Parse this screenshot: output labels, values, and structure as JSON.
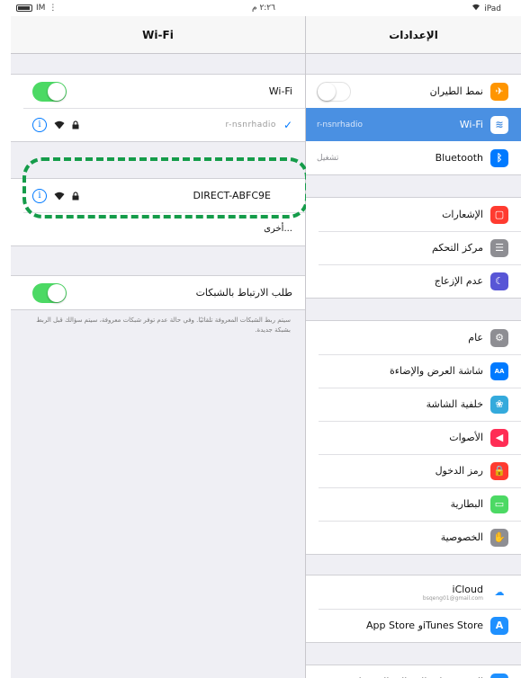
{
  "status_bar": {
    "carrier": "IM",
    "time": "٢:٢٦ م",
    "device": "iPad"
  },
  "detail": {
    "title": "Wi-Fi",
    "wifi_label": "Wi-Fi",
    "wifi_on": true,
    "connected_network": "r-nsnrhadio",
    "highlighted_network": "DIRECT-ABFC9E",
    "other_label": "أخرى...",
    "ask_to_join_label": "طلب الارتباط بالشبكات",
    "ask_to_join_on": true,
    "ask_to_join_note": "سيتم ربط الشبكات المعروفة تلقائيًا. وفي حالة عدم توفر شبكات معروفة، سيتم سؤالك قبل الربط بشبكة جديدة."
  },
  "master": {
    "title": "الإعدادات",
    "groups": [
      [
        {
          "name": "airplane",
          "label": "نمط الطيران",
          "icon": "airplane-icon",
          "color": "#ff9500",
          "glyph": "✈",
          "toggle": "off"
        },
        {
          "name": "wifi",
          "label": "Wi-Fi",
          "value": "r-nsnrhadio",
          "icon": "wifi-icon",
          "color": "#007aff",
          "glyph": "≋",
          "selected": true
        },
        {
          "name": "bluetooth",
          "label": "Bluetooth",
          "value": "تشغيل",
          "icon": "bluetooth-icon",
          "color": "#007aff",
          "glyph": "ᛒ"
        }
      ],
      [
        {
          "name": "notifications",
          "label": "الإشعارات",
          "icon": "notifications-icon",
          "color": "#ff3b30",
          "glyph": "▢"
        },
        {
          "name": "control-center",
          "label": "مركز التحكم",
          "icon": "control-center-icon",
          "color": "#8e8e93",
          "glyph": "☰"
        },
        {
          "name": "do-not-disturb",
          "label": "عدم الإزعاج",
          "icon": "moon-icon",
          "color": "#5856d6",
          "glyph": "☾"
        }
      ],
      [
        {
          "name": "general",
          "label": "عام",
          "icon": "gear-icon",
          "color": "#8e8e93",
          "glyph": "⚙"
        },
        {
          "name": "display",
          "label": "شاشة العرض والإضاءة",
          "icon": "display-brightness-icon",
          "color": "#007aff",
          "glyph": "AA"
        },
        {
          "name": "wallpaper",
          "label": "خلفية الشاشة",
          "icon": "wallpaper-icon",
          "color": "#34aadc",
          "glyph": "❀"
        },
        {
          "name": "sounds",
          "label": "الأصوات",
          "icon": "speaker-icon",
          "color": "#ff2d55",
          "glyph": "◀"
        },
        {
          "name": "passcode",
          "label": "رمز الدخول",
          "icon": "lock-icon",
          "color": "#ff3b30",
          "glyph": "🔒"
        },
        {
          "name": "battery",
          "label": "البطارية",
          "icon": "battery-icon",
          "color": "#4cd964",
          "glyph": "▭"
        },
        {
          "name": "privacy",
          "label": "الخصوصية",
          "icon": "hand-icon",
          "color": "#8e8e93",
          "glyph": "✋"
        }
      ],
      [
        {
          "name": "icloud",
          "label": "iCloud",
          "sub": "bsqeng01@gmail.com",
          "icon": "cloud-icon",
          "color": "#ffffff",
          "glyph": "☁",
          "glyph_color": "#1e90ff"
        },
        {
          "name": "app-store",
          "label": "App Store وiTunes Store",
          "icon": "app-store-icon",
          "color": "#1e90ff",
          "glyph": "A"
        }
      ],
      [
        {
          "name": "mail",
          "label": "البريد وجهات الاتصال والتقويمات",
          "icon": "mail-icon",
          "color": "#1e90ff",
          "glyph": "✉"
        }
      ]
    ]
  }
}
